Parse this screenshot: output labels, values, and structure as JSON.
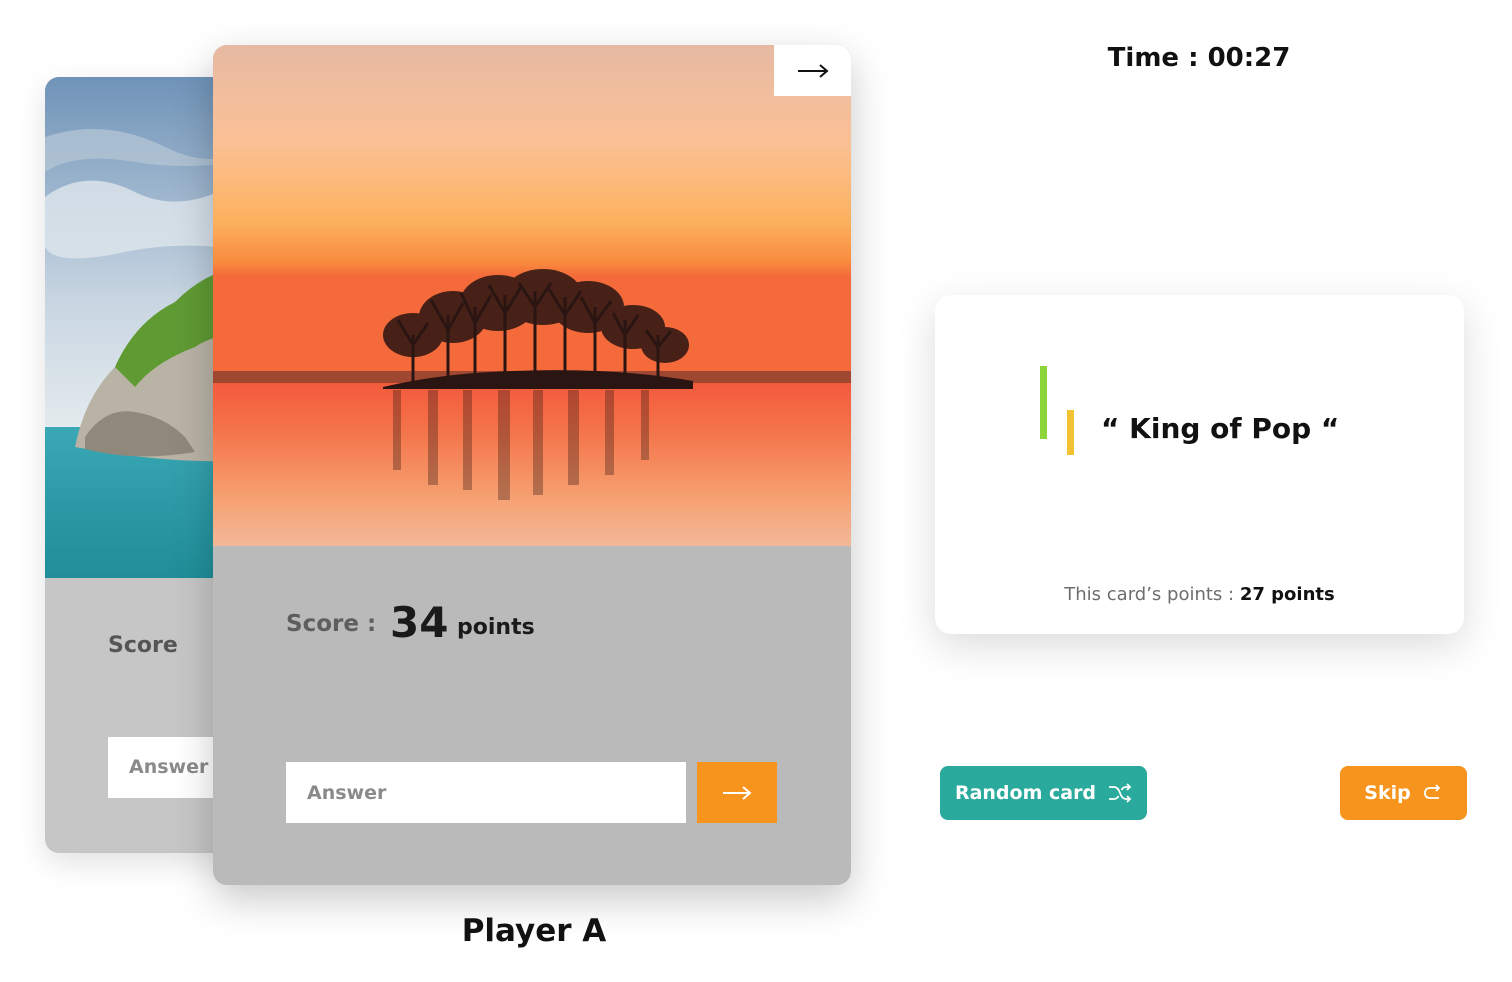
{
  "timer": {
    "label": "Time :",
    "value": "00:27"
  },
  "back_card": {
    "score_label": "Score",
    "answer_placeholder": "Answer"
  },
  "front_card": {
    "score_label": "Score :",
    "score_value": "34",
    "score_unit": "points",
    "answer_placeholder": "Answer",
    "player_name": "Player A"
  },
  "clue_card": {
    "clue": "“ King of Pop “",
    "points_label": "This card’s points :",
    "points_value": "27 points"
  },
  "actions": {
    "random_label": "Random card",
    "skip_label": "Skip"
  },
  "icons": {
    "corner": "arrow-right-icon",
    "submit": "arrow-right-icon",
    "random": "shuffle-icon",
    "skip": "redo-icon"
  },
  "colors": {
    "accent_orange": "#f7941d",
    "accent_teal": "#2aaa9c",
    "bar_green": "#8bd43a",
    "bar_yellow": "#f1c232",
    "front_card_bg": "#bababa",
    "back_card_bg": "#c6c6c6"
  }
}
